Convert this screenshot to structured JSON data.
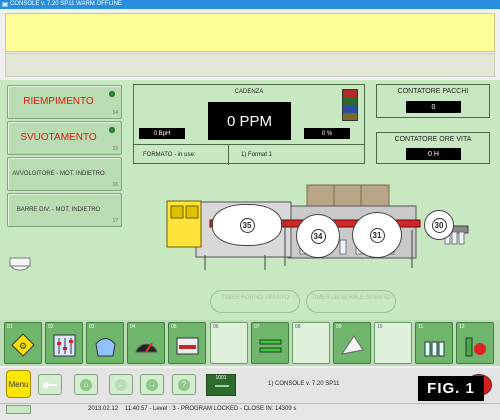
{
  "window": {
    "title": "CONSOLE v. 7.20 SP11  WARM OFFLINE"
  },
  "left_buttons": [
    {
      "label": "RIEMPIMENTO",
      "number": "14"
    },
    {
      "label": "SVUOTAMENTO",
      "number": "15"
    },
    {
      "label": "AVVOLGITORE - MOT. INDIETRO",
      "number": "16"
    },
    {
      "label": "BARRE DIV. - MOT. INDIETRO",
      "number": "17"
    }
  ],
  "cadenza": {
    "title": "CADENZA",
    "ppm": "0 PPM",
    "bph": "0 BpH",
    "percent": "0 %",
    "stack_colors": [
      "#b02a2a",
      "#2c6a2c",
      "#2c4ea0",
      "#7a6a2a"
    ]
  },
  "formato": {
    "label": "FORMATO - in use:",
    "value": "1) Format 1"
  },
  "contatore_pacchi": {
    "title": "CONTATORE PACCHI",
    "value": "0"
  },
  "contatore_ore": {
    "title": "CONTATORE ORE VITA",
    "value": "0 H"
  },
  "machine": {
    "stations": [
      "35",
      "34",
      "31",
      "30"
    ]
  },
  "timers": [
    {
      "label": "TIMER FORNO SPENTO"
    },
    {
      "label": "TIMER GENERALE SPENTO"
    }
  ],
  "toolbar": {
    "items": [
      {
        "num": "01",
        "icon": "warning-diamond-icon",
        "empty": false
      },
      {
        "num": "02",
        "icon": "sliders-icon",
        "empty": false
      },
      {
        "num": "03",
        "icon": "basket-icon",
        "empty": false
      },
      {
        "num": "04",
        "icon": "speedometer-icon",
        "empty": false
      },
      {
        "num": "05",
        "icon": "machine-icon",
        "empty": false
      },
      {
        "num": "06",
        "icon": "",
        "empty": true
      },
      {
        "num": "07",
        "icon": "conveyor-icon",
        "empty": false
      },
      {
        "num": "08",
        "icon": "",
        "empty": true
      },
      {
        "num": "09",
        "icon": "film-roll-icon",
        "empty": false
      },
      {
        "num": "10",
        "icon": "",
        "empty": true
      },
      {
        "num": "11",
        "icon": "bottles-icon",
        "empty": false
      },
      {
        "num": "12",
        "icon": "bottle-stop-icon",
        "empty": false
      }
    ]
  },
  "bottom": {
    "menu_label": "Menu",
    "program_number": "1001",
    "console_text": "1) CONSOLE v. 7.20 SP11",
    "fig_label": "FIG. 1"
  },
  "status": {
    "date": "2013.02.12",
    "time": "11:40:57",
    "text": "- Level : 3 - PROGRAM LOCKED - CLOSE IN: 14309 s"
  }
}
